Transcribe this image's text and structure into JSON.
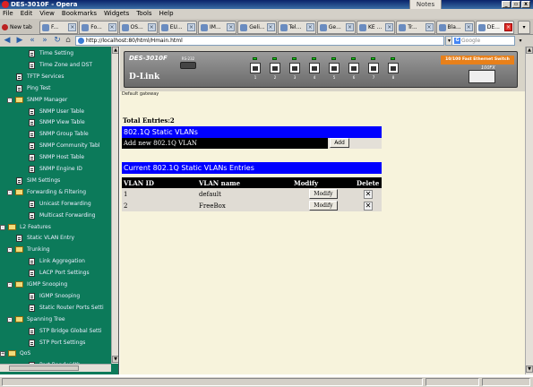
{
  "window": {
    "title": "DES-3010F - Opera",
    "notes_tab": "Notes",
    "controls": [
      "_",
      "▫",
      "x"
    ]
  },
  "menu": [
    "File",
    "Edit",
    "View",
    "Bookmarks",
    "Widgets",
    "Tools",
    "Help"
  ],
  "tabs": {
    "new_tab": "New tab",
    "items": [
      {
        "label": "F..."
      },
      {
        "label": "Fo..."
      },
      {
        "label": "OS..."
      },
      {
        "label": "EU..."
      },
      {
        "label": "IM..."
      },
      {
        "label": "Geli..."
      },
      {
        "label": "Tel..."
      },
      {
        "label": "Ge..."
      },
      {
        "label": "KE ..."
      },
      {
        "label": "Tr..."
      },
      {
        "label": "Bla..."
      },
      {
        "label": "DE..."
      }
    ]
  },
  "address": {
    "url": "http://localhost:80/html/Hmain.html",
    "search_placeholder": "Google"
  },
  "nav": {
    "items": [
      {
        "label": "Time Setting",
        "kind": "page",
        "level": 2
      },
      {
        "label": "Time Zone and DST",
        "kind": "page",
        "level": 2
      },
      {
        "label": "TFTP Services",
        "kind": "page",
        "level": 1
      },
      {
        "label": "Ping Test",
        "kind": "page",
        "level": 1
      },
      {
        "label": "SNMP Manager",
        "kind": "folder",
        "level": 1,
        "expander": "-"
      },
      {
        "label": "SNMP User Table",
        "kind": "page",
        "level": 2
      },
      {
        "label": "SNMP View Table",
        "kind": "page",
        "level": 2
      },
      {
        "label": "SNMP Group Table",
        "kind": "page",
        "level": 2
      },
      {
        "label": "SNMP Community Tabl",
        "kind": "page",
        "level": 2
      },
      {
        "label": "SNMP Host Table",
        "kind": "page",
        "level": 2
      },
      {
        "label": "SNMP Engine ID",
        "kind": "page",
        "level": 2
      },
      {
        "label": "SIM Settings",
        "kind": "page",
        "level": 1
      },
      {
        "label": "Forwarding & Filtering",
        "kind": "folder",
        "level": 1,
        "expander": "-"
      },
      {
        "label": "Unicast Forwarding",
        "kind": "page",
        "level": 2
      },
      {
        "label": "Multicast Forwarding",
        "kind": "page",
        "level": 2
      },
      {
        "label": "L2 Features",
        "kind": "folder",
        "level": 0,
        "expander": "-"
      },
      {
        "label": "Static VLAN Entry",
        "kind": "page",
        "level": 1
      },
      {
        "label": "Trunking",
        "kind": "folder",
        "level": 1,
        "expander": "-"
      },
      {
        "label": "Link Aggregation",
        "kind": "page",
        "level": 2
      },
      {
        "label": "LACP Port Settings",
        "kind": "page",
        "level": 2
      },
      {
        "label": "IGMP Snooping",
        "kind": "folder",
        "level": 1,
        "expander": "-"
      },
      {
        "label": "IGMP Snooping",
        "kind": "page",
        "level": 2
      },
      {
        "label": "Static Router Ports Setti",
        "kind": "page",
        "level": 2
      },
      {
        "label": "Spanning Tree",
        "kind": "folder",
        "level": 1,
        "expander": "-"
      },
      {
        "label": "STP Bridge Global Setti",
        "kind": "page",
        "level": 2
      },
      {
        "label": "STP Port Settings",
        "kind": "page",
        "level": 2
      },
      {
        "label": "QoS",
        "kind": "folder",
        "level": 0,
        "expander": "+"
      },
      {
        "label": "Port Bandwidth",
        "kind": "page",
        "level": 2
      }
    ]
  },
  "device": {
    "model": "DES-3010F",
    "brand": "D-Link",
    "rs232": "RS-232",
    "fx_label": "10/100 Fast Ethernet Switch",
    "fx_port": "100FX",
    "ports": [
      "1",
      "2",
      "3",
      "4",
      "5",
      "6",
      "7",
      "8"
    ],
    "default_gateway_label": "Default gateway"
  },
  "content": {
    "total": "Total Entries:2",
    "section1": "802.1Q Static VLANs",
    "add_label": "Add new 802.1Q VLAN",
    "add_button": "Add",
    "section2": "Current 802.1Q Static VLANs Entries",
    "columns": [
      "VLAN ID",
      "VLAN name",
      "Modify",
      "Delete"
    ],
    "rows": [
      {
        "id": "1",
        "name": "default",
        "modify": "Modify",
        "delete": "✕"
      },
      {
        "id": "2",
        "name": "FreeBox",
        "modify": "Modify",
        "delete": "✕"
      }
    ]
  }
}
